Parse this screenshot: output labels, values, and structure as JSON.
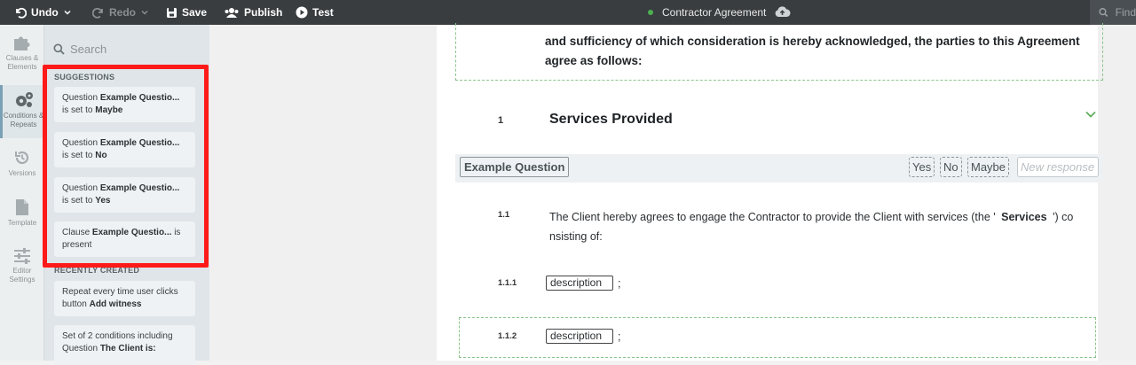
{
  "toolbar": {
    "undo": "Undo",
    "redo": "Redo",
    "save": "Save",
    "publish": "Publish",
    "test": "Test",
    "document_title": "Contractor Agreement",
    "find_placeholder": "Find"
  },
  "rail": {
    "items": [
      {
        "label": "Clauses & Elements",
        "icon": "puzzle-icon",
        "active": false
      },
      {
        "label": "Conditions & Repeats",
        "icon": "gears-icon",
        "active": true
      },
      {
        "label": "Versions",
        "icon": "history-icon",
        "active": false
      },
      {
        "label": "Template",
        "icon": "document-icon",
        "active": false
      },
      {
        "label": "Editor Settings",
        "icon": "sliders-icon",
        "active": false
      }
    ]
  },
  "panel": {
    "search_placeholder": "Search",
    "suggestions_heading": "SUGGESTIONS",
    "suggestions": [
      {
        "prefix": "Question",
        "name": "Example Questio...",
        "mid": "is set to",
        "value": "Maybe"
      },
      {
        "prefix": "Question",
        "name": "Example Questio...",
        "mid": "is set to",
        "value": "No"
      },
      {
        "prefix": "Question",
        "name": "Example Questio...",
        "mid": "is set to",
        "value": "Yes"
      },
      {
        "prefix": "Clause",
        "name": "Example Questio...",
        "mid": "is",
        "value": "present"
      }
    ],
    "recent_heading": "RECENTLY CREATED",
    "recent": [
      {
        "line1": "Repeat every time user clicks",
        "line2_prefix": "button",
        "line2_bold": "Add witness"
      },
      {
        "line1": "Set of 2 conditions including",
        "line2_prefix": "Question",
        "line2_bold": "The Client is:"
      }
    ]
  },
  "document": {
    "recitals": "and sufficiency of which consideration is hereby acknowledged, the parties to this Agreement agree as follows:",
    "section_number": "1",
    "section_title": "Services Provided",
    "question_label": "Example Question",
    "options": [
      "Yes",
      "No",
      "Maybe"
    ],
    "new_response_placeholder": "New response",
    "clause_number": "1.1",
    "clause_text_before": "The Client hereby agrees to engage the Contractor to provide the Client with services (the '",
    "clause_term": "Services",
    "clause_text_after": "') co nsisting of:",
    "sub_items": [
      {
        "number": "1.1.1",
        "field": "description",
        "suffix": ";"
      },
      {
        "number": "1.1.2",
        "field": "description",
        "suffix": ";"
      }
    ]
  },
  "colors": {
    "topbar": "#393d40",
    "panel": "#dfe5e8",
    "highlight": "#ff1a1a",
    "accent_green": "#4caf50"
  }
}
